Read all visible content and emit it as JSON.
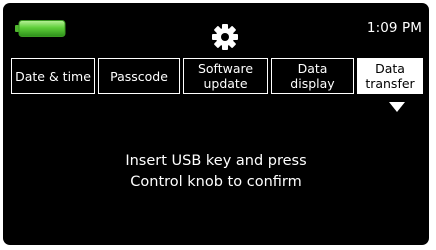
{
  "status_bar": {
    "battery_icon": "battery-full-icon",
    "battery_color": "#6fd04a",
    "settings_icon": "gear-icon",
    "time": "1:09 PM"
  },
  "tabs": [
    {
      "line1": "Date & time",
      "line2": ""
    },
    {
      "line1": "Passcode",
      "line2": ""
    },
    {
      "line1": "Software",
      "line2": "update"
    },
    {
      "line1": "Data",
      "line2": "display"
    },
    {
      "line1": "Data",
      "line2": "transfer"
    }
  ],
  "active_tab": "Data transfer",
  "message": {
    "line1": "Insert USB key and press",
    "line2": "Control knob to confirm"
  }
}
